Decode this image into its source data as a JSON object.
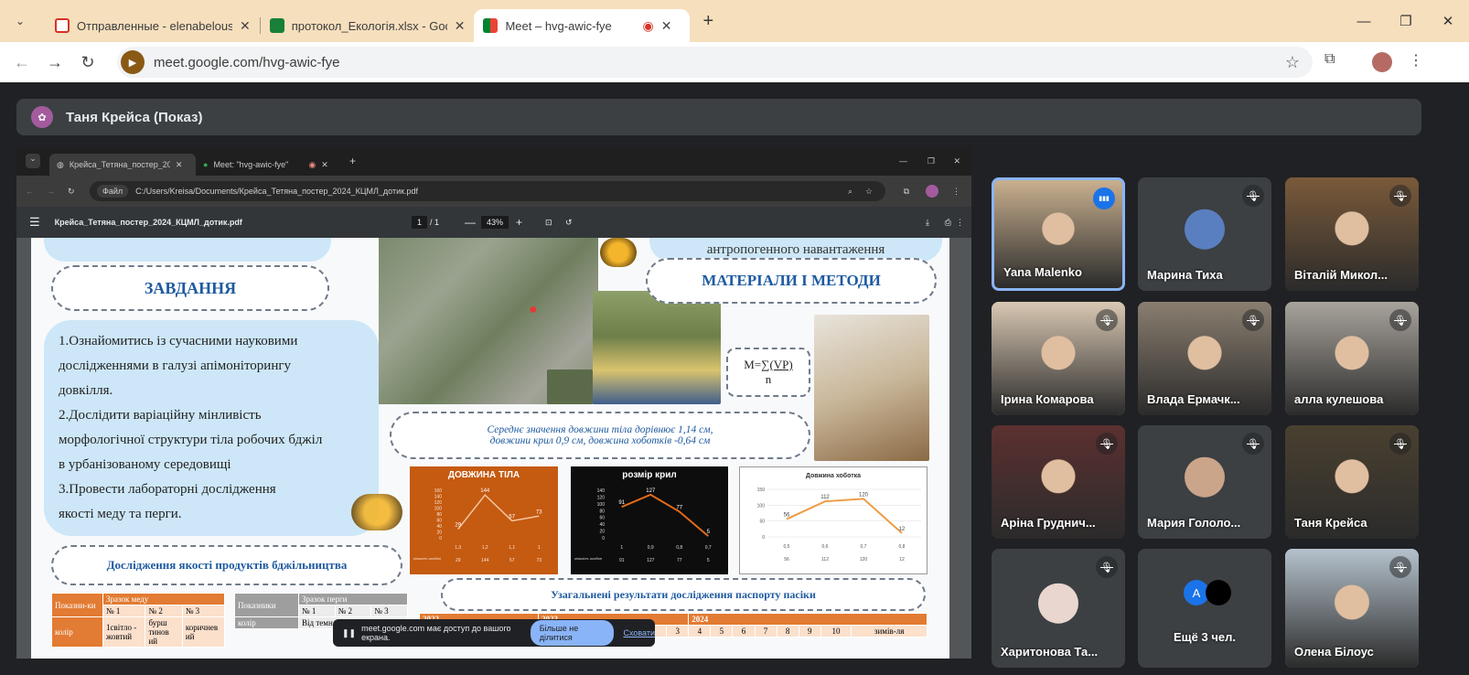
{
  "browser": {
    "tabs": [
      {
        "title": "Отправленные - elenabelous2(",
        "favicon_color": "#d93025"
      },
      {
        "title": "протокол_Екологія.xlsx - Goog",
        "favicon_color": "#188038"
      },
      {
        "title": "Meet – hvg-awic-fye",
        "favicon_color": "#00832d"
      }
    ],
    "url": "meet.google.com/hvg-awic-fye"
  },
  "meet": {
    "presenter_label": "Таня Крейса (Показ)"
  },
  "shared": {
    "tab1": "Крейса_Тетяна_постер_2024_К",
    "tab2": "Meet: \"hvg-awic-fye\"",
    "file_label": "Файл",
    "path": "C:/Users/Kreisa/Documents/Крейса_Тетяна_постер_2024_КЦМЛ_дотик.pdf",
    "pdf_title": "Крейса_Тетяна_постер_2024_КЦМЛ_дотик.pdf",
    "page": "1",
    "pages": "/ 1",
    "zoom": "43%",
    "poster": {
      "tasks_heading": "ЗАВДАННЯ",
      "methods_heading": "МАТЕРІАЛИ І МЕТОДИ",
      "top_right_text": "антропогенного навантаження",
      "task1a": "1.Ознайомитись із сучасними науковими",
      "task1b": "дослідженнями в галузі апімоніторингу",
      "task1c": "довкілля.",
      "task2a": "2.Дослідити варіаційну мінливість",
      "task2b": "морфологічної структури тіла робочих бджіл",
      "task2c": "в урбанізованому середовищі",
      "task3a": "3.Провести лабораторні дослідження",
      "task3b": "якості меду та перги.",
      "formula_m": "M=",
      "formula_sum": "∑(VP)",
      "formula_n": "n",
      "mean_line1": "Середнє значення довжини тіла  дорівнює 1,14 см,",
      "mean_line2": "довжини крил 0,9 см, довжина хоботків -0,64 см",
      "quality_heading": "Дослідження  якості продуктів бджільництва",
      "passport_heading": "Узагальнені результати дослідження паспорту пасіки",
      "chart1_title": "ДОВЖИНА ТІЛА",
      "chart2_title": "розмір крил",
      "chart3_title": "Довжина хоботка",
      "honey_table": {
        "h1": "Показни-ки",
        "h2": "Зразок меду",
        "c1": "№ 1",
        "c2": "№ 2",
        "c3": "№ 3",
        "r1": "колір",
        "v1": "1світло - жовтий",
        "v2": "бурш тинов ий",
        "v3": "коричнев ий"
      },
      "perga_table": {
        "h1": "Показники",
        "h2": "Зразок перги",
        "c1": "№ 1",
        "c2": "№ 2",
        "c3": "№ 3",
        "r1": "колір",
        "v1": "Від темн коричне"
      },
      "passport_table": {
        "y1": "2022",
        "y2": "2023",
        "y3": "2024",
        "cols": [
          "9",
          "10",
          "зимів-ля",
          "3",
          "4",
          "5",
          "6",
          "7",
          "8",
          "9",
          "10",
          "зимів-ля"
        ]
      }
    },
    "banner_text": "meet.google.com має доступ до вашого екрана.",
    "banner_stop": "Більше не ділитися",
    "banner_hide": "Сховати"
  },
  "chart_data": [
    {
      "type": "line",
      "title": "ДОВЖИНА ТІЛА",
      "categories": [
        "1,3",
        "1,2",
        "1,1",
        "1"
      ],
      "values": [
        29,
        144,
        57,
        73
      ],
      "ylim": [
        0,
        160
      ],
      "legend": "кількість особин"
    },
    {
      "type": "line",
      "title": "розмір крил",
      "categories": [
        "1",
        "0,9",
        "0,8",
        "0,7"
      ],
      "values": [
        91,
        127,
        77,
        5
      ],
      "ylim": [
        0,
        140
      ],
      "legend": "кількість особин"
    },
    {
      "type": "line",
      "title": "Довжина хоботка",
      "categories": [
        "0,5",
        "0,6",
        "0,7",
        "0,8"
      ],
      "values": [
        56,
        112,
        120,
        12
      ],
      "ylim": [
        0,
        150
      ]
    }
  ],
  "participants": [
    {
      "name": "Yana Malenko",
      "speaking": true,
      "bg": "#c9b08f"
    },
    {
      "name": "Марина Тиха",
      "avatar": true,
      "bg": "#3c4043",
      "avatar_color": "#5a7fc0"
    },
    {
      "name": "Віталій Микол...",
      "bg": "#7a5a3a"
    },
    {
      "name": "Ірина Комарова",
      "bg": "#d9c8b3"
    },
    {
      "name": "Влада Ермачк...",
      "bg": "#8a7e70"
    },
    {
      "name": "алла кулешова",
      "bg": "#a8a39c"
    },
    {
      "name": "Аріна Груднич...",
      "bg": "#5c3030"
    },
    {
      "name": "Мария Гололо...",
      "avatar": true,
      "bg": "#3c4043",
      "avatar_color": "#caa58a"
    },
    {
      "name": "Таня Крейса",
      "bg": "#4a4030"
    },
    {
      "name": "Харитонова Та...",
      "avatar": true,
      "bg": "#3c4043",
      "avatar_color": "#e9d6ce"
    },
    {
      "name": "Ещё 3 чел.",
      "bg": "#3c4043",
      "letter": "A"
    },
    {
      "name": "Олена Білоус",
      "bg": "#b5c2cc"
    }
  ]
}
